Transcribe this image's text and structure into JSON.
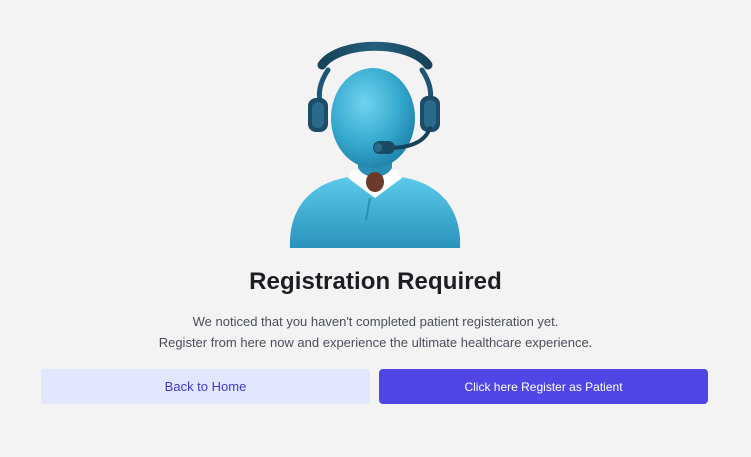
{
  "page": {
    "title": "Registration Required",
    "description_line1": "We noticed that you haven't completed patient registeration yet.",
    "description_line2": "Register from here now and experience the ultimate healthcare experience."
  },
  "illustration": {
    "icon": "support-agent-headset-icon"
  },
  "buttons": {
    "back_home_label": "Back to Home",
    "register_label": "Click here Register as Patient"
  },
  "colors": {
    "background": "#f3f3f4",
    "primary": "#4f46e5",
    "secondary_bg": "#e0e7ff",
    "secondary_text": "#4338ca",
    "agent_body": "#3cb3d6"
  }
}
